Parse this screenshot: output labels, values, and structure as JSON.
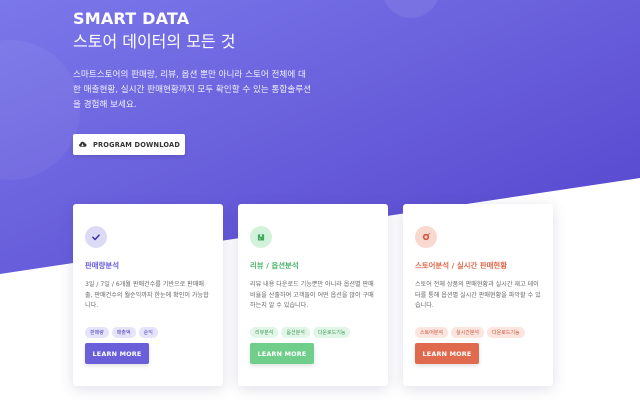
{
  "hero": {
    "title": "SMART DATA",
    "subtitle": "스토어 데이터의 모든 것",
    "description": "스마트스토어의 판매량, 리뷰, 옵션 뿐만 아니라 스토어 전체에 대한 매출현황, 실시간 판매현황까지 모두 확인할 수 있는 통합솔루션을 경험해 보세요.",
    "download_label": "PROGRAM DOWNLOAD"
  },
  "colors": {
    "hero_gradient_start": "#7b7be8",
    "hero_gradient_end": "#5a4bd4",
    "card1_accent": "#6a5fd8",
    "card2_accent": "#6fcf8a",
    "card3_accent": "#e06a4e"
  },
  "cards": [
    {
      "icon": "check-icon",
      "title": "판매량분석",
      "description": "3일 / 7일 / 6개월 판매건수를 기반으로 판매매출, 판매건수의 월순익까지 한눈에 확인이 가능합니다.",
      "tags": [
        "판매량",
        "매출액",
        "순익"
      ],
      "button_label": "LEARN MORE"
    },
    {
      "icon": "box-icon",
      "title": "리뷰 / 옵션분석",
      "description": "리뷰 내용 다운로드 기능뿐만 아니라 옵션별 판매비율을 산출하여 고객들이 어떤 옵션을 많이 구매하는지 알 수 있습니다.",
      "tags": [
        "리뷰분석",
        "옵션분석",
        "다운로드기능"
      ],
      "button_label": "LEARN MORE"
    },
    {
      "icon": "target-icon",
      "title": "스토어분석 / 실시간 판매현황",
      "description": "스토어 전체 상품의 판매현황과 실시간 재고 데이터를 통해 옵션별 실시간 판매현황을 파악할 수 있습니다.",
      "tags": [
        "스토어분석",
        "실시간분석",
        "다운로드기능"
      ],
      "button_label": "LEARN MORE"
    }
  ]
}
